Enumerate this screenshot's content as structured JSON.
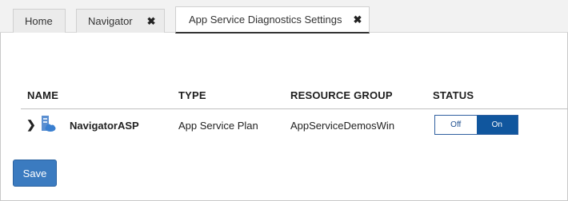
{
  "tabs": [
    {
      "label": "Home",
      "closable": false
    },
    {
      "label": "Navigator",
      "closable": true
    },
    {
      "label": "App Service Diagnostics Settings",
      "closable": true,
      "active": true
    }
  ],
  "close_glyph": "✖",
  "table": {
    "columns": [
      "NAME",
      "TYPE",
      "RESOURCE GROUP",
      "STATUS"
    ],
    "rows": [
      {
        "name": "NavigatorASP",
        "type": "App Service Plan",
        "resource_group": "AppServiceDemosWin",
        "status": {
          "off_label": "Off",
          "on_label": "On",
          "selected": "On"
        }
      }
    ]
  },
  "icons": {
    "expand": "chevron-right-icon",
    "resource": "app-service-plan-icon"
  },
  "colors": {
    "toggle_on": "#10569e",
    "save_button": "#3b7bc0",
    "tab_active_underline": "#333333"
  },
  "save_label": "Save"
}
